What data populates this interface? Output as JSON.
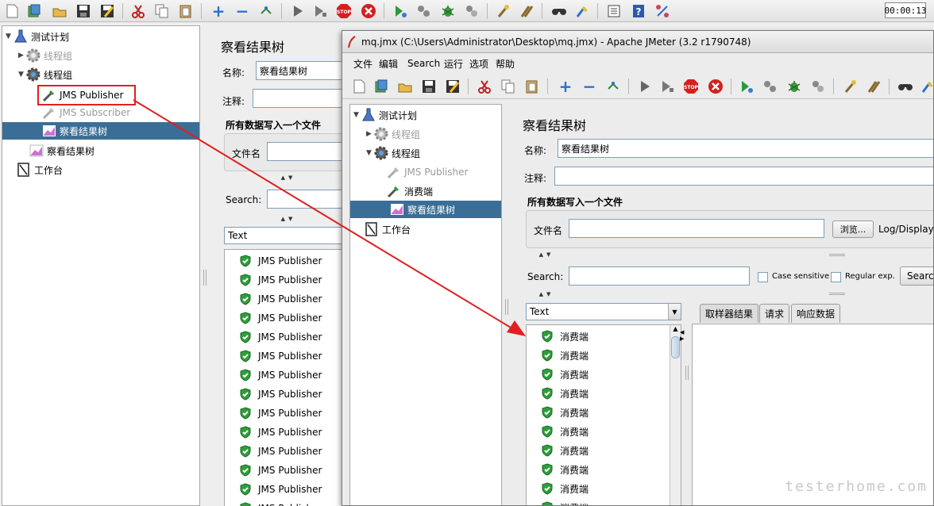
{
  "toolbar": {
    "icons": [
      "new-icon",
      "templates-icon",
      "open-icon",
      "save-icon",
      "save-as-icon",
      "cut-icon",
      "copy-icon",
      "paste-icon",
      "expand-icon",
      "collapse-icon",
      "toggle-icon",
      "start-icon",
      "start-no-pause-icon",
      "stop-icon",
      "shutdown-icon",
      "remote-start-icon",
      "remote-stop-icon",
      "remote-shutdown-icon",
      "clear-icon",
      "clear-all-icon",
      "search-icon",
      "reset-search-icon",
      "function-helper-icon",
      "help-icon",
      "remote-icon"
    ],
    "timer": "00:00:13"
  },
  "tree": {
    "items": [
      {
        "label": "测试计划"
      },
      {
        "label": "线程组"
      },
      {
        "label": "线程组"
      },
      {
        "label": "JMS Publisher"
      },
      {
        "label": "JMS Subscriber"
      },
      {
        "label": "察看结果树"
      },
      {
        "label": "察看结果树"
      },
      {
        "label": "工作台"
      }
    ]
  },
  "back_panel": {
    "title": "察看结果树",
    "name_label": "名称:",
    "name_value": "察看结果树",
    "comment_label": "注释:",
    "group_title": "所有数据写入一个文件",
    "filename_label": "文件名",
    "search_label": "Search:",
    "renderer": "Text",
    "results": [
      "JMS Publisher",
      "JMS Publisher",
      "JMS Publisher",
      "JMS Publisher",
      "JMS Publisher",
      "JMS Publisher",
      "JMS Publisher",
      "JMS Publisher",
      "JMS Publisher",
      "JMS Publisher",
      "JMS Publisher",
      "JMS Publisher",
      "JMS Publisher",
      "JMS Publisher"
    ]
  },
  "window": {
    "title": "mq.jmx (C:\\Users\\Administrator\\Desktop\\mq.jmx) - Apache JMeter (3.2 r1790748)",
    "menu": [
      "文件",
      "编辑",
      "Search",
      "运行",
      "选项",
      "帮助"
    ],
    "tree": [
      {
        "label": "测试计划"
      },
      {
        "label": "线程组"
      },
      {
        "label": "线程组"
      },
      {
        "label": "JMS Publisher"
      },
      {
        "label": "消费端"
      },
      {
        "label": "察看结果树"
      },
      {
        "label": "工作台"
      }
    ],
    "panel": {
      "title": "察看结果树",
      "name_label": "名称:",
      "name_value": "察看结果树",
      "comment_label": "注释:",
      "group_title": "所有数据写入一个文件",
      "filename_label": "文件名",
      "browse_label": "浏览...",
      "log_label": "Log/Display O",
      "search_label": "Search:",
      "case_sensitive": "Case sensitive",
      "regex": "Regular exp.",
      "search_button": "Searc",
      "renderer": "Text",
      "tabs": [
        "取样器结果",
        "请求",
        "响应数据"
      ],
      "results": [
        "消费端",
        "消费端",
        "消费端",
        "消费端",
        "消费端",
        "消费端",
        "消费端",
        "消费端",
        "消费端",
        "消费端"
      ]
    }
  },
  "watermark": "testerhome.com",
  "colors": {
    "selection": "#3b6e96",
    "annotation": "#e02020",
    "shield": "#2e9e3a"
  }
}
